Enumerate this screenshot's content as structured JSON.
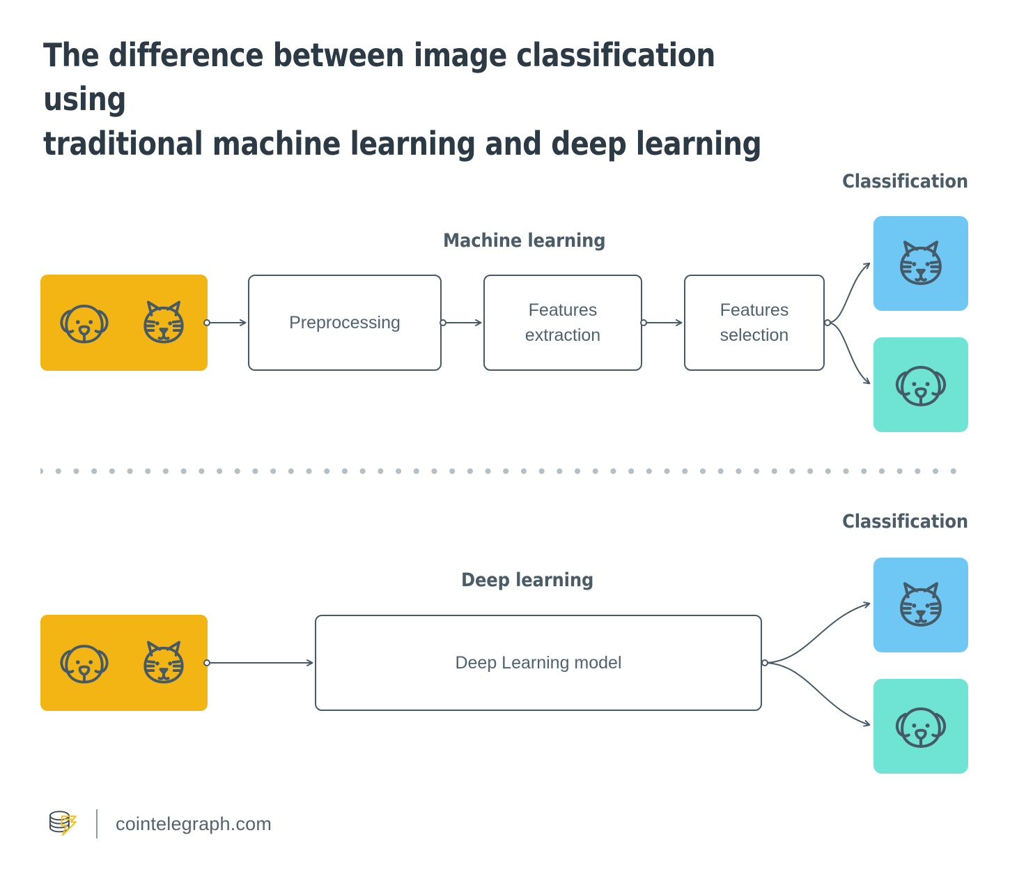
{
  "title": "The difference between image classification using\ntraditional machine learning and deep learning",
  "colors": {
    "input_yellow": "#F2B513",
    "cat_blue": "#6FC8F4",
    "dog_teal": "#6FE4D4",
    "line": "#455A66",
    "text": "#4E6371",
    "heading": "#4A5C68",
    "title": "#2B3A45",
    "divider_dot": "#B4C0C7"
  },
  "machine_learning": {
    "section_label": "Machine learning",
    "classification_label": "Classification",
    "input": {
      "name": "input-images",
      "icons": [
        "dog-face-icon",
        "cat-face-icon"
      ]
    },
    "steps": [
      {
        "label": "Preprocessing"
      },
      {
        "label": "Features\nextraction"
      },
      {
        "label": "Features\nselection"
      }
    ],
    "outputs": [
      {
        "icon": "cat-face-icon",
        "color": "#6FC8F4"
      },
      {
        "icon": "dog-face-icon",
        "color": "#6FE4D4"
      }
    ]
  },
  "deep_learning": {
    "section_label": "Deep learning",
    "classification_label": "Classification",
    "input": {
      "name": "input-images",
      "icons": [
        "dog-face-icon",
        "cat-face-icon"
      ]
    },
    "steps": [
      {
        "label": "Deep Learning model"
      }
    ],
    "outputs": [
      {
        "icon": "cat-face-icon",
        "color": "#6FC8F4"
      },
      {
        "icon": "dog-face-icon",
        "color": "#6FE4D4"
      }
    ]
  },
  "footer": {
    "logo": "cointelegraph-coins-bolt-logo",
    "url": "cointelegraph.com"
  }
}
